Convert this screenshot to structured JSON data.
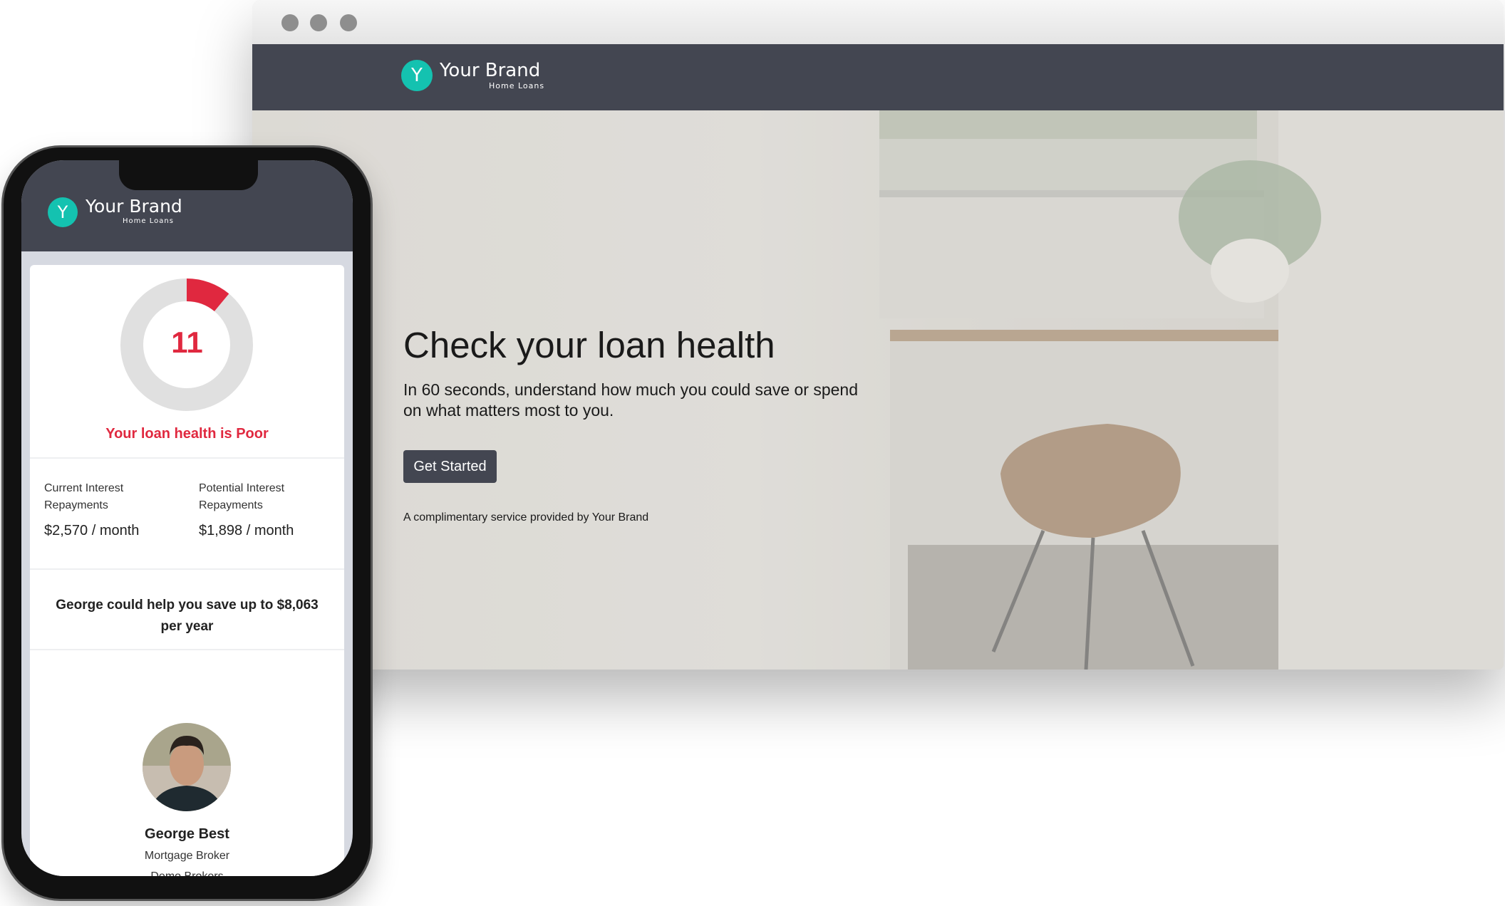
{
  "browser": {
    "brand": {
      "initial": "Y",
      "name": "Your Brand",
      "subtitle": "Home Loans",
      "color": "#14c2b0"
    },
    "hero": {
      "heading": "Check your loan health",
      "subheading": "In 60 seconds, understand how much you could save or spend on what matters most to you.",
      "cta_label": "Get Started",
      "footnote": "A complimentary service provided by Your Brand"
    }
  },
  "phone": {
    "brand": {
      "initial": "Y",
      "name": "Your Brand",
      "subtitle": "Home Loans"
    },
    "gauge": {
      "score": "11",
      "score_value": 11,
      "color": "#e0283f",
      "track_color": "#e0e0e0"
    },
    "health_text": "Your loan health is Poor",
    "stats": [
      {
        "label": "Current Interest Repayments",
        "value": "$2,570 / month"
      },
      {
        "label": "Potential Interest Repayments",
        "value": "$1,898 / month"
      }
    ],
    "savings_text": "George could help you save up to $8,063 per year",
    "broker": {
      "name": "George Best",
      "title": "Mortgage Broker",
      "company": "Demo Brokers"
    }
  }
}
